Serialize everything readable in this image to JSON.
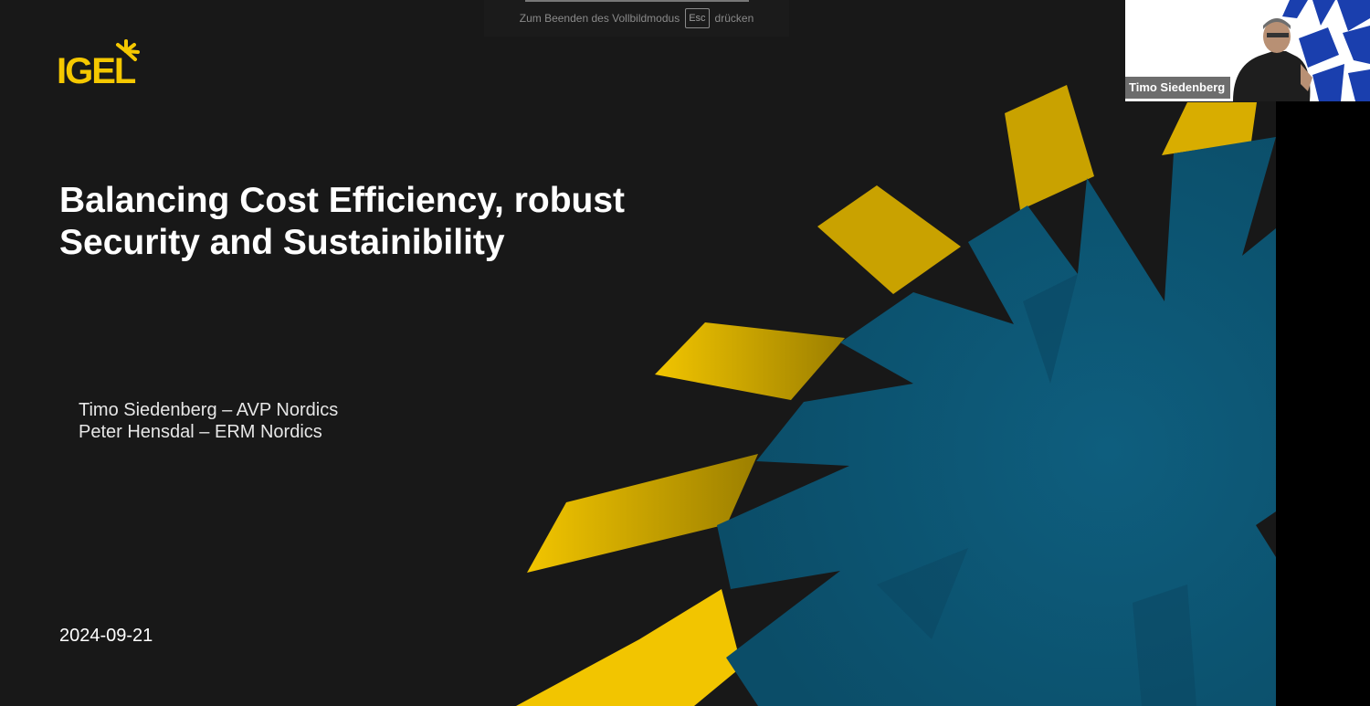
{
  "slide": {
    "logo_text": "IGEL",
    "title_line1": "Balancing Cost Efficiency, robust",
    "title_line2": "Security and Sustainibility",
    "presenters": [
      "Timo Siedenberg – AVP Nordics",
      "Peter Hensdal – ERM Nordics"
    ],
    "date": "2024-09-21"
  },
  "fullscreen_banner": {
    "text_before": "Zum Beenden des Vollbildmodus",
    "key": "Esc",
    "text_after": "drücken"
  },
  "video_tile": {
    "participant_name": "Timo Siedenberg"
  },
  "colors": {
    "slide_bg": "#181818",
    "accent_yellow": "#f5c800",
    "accent_teal": "#0f5a78"
  }
}
